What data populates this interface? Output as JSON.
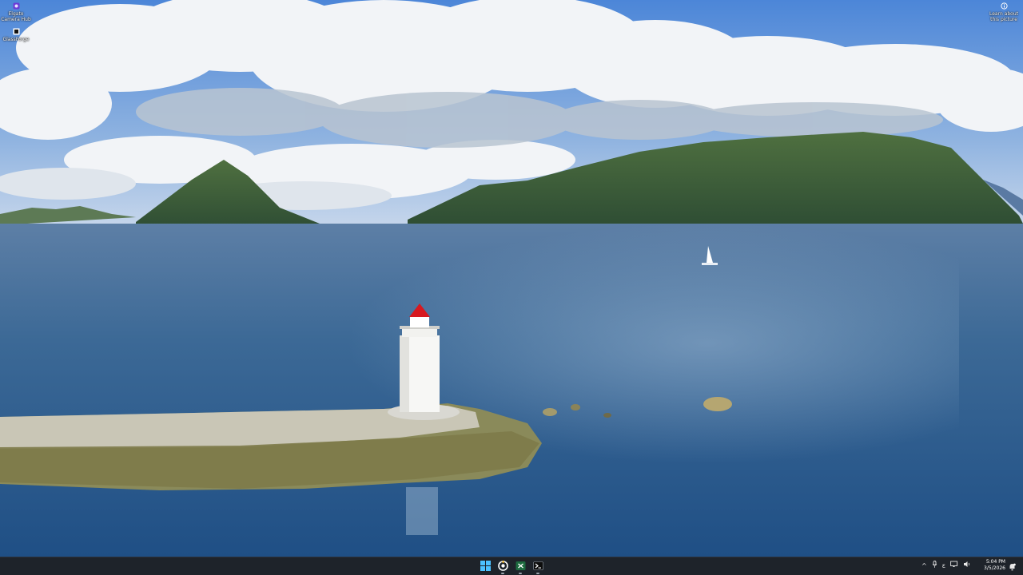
{
  "desktop": {
    "icons": [
      {
        "label": "Elgato Camera Hub",
        "icon": "camera-hub-icon"
      },
      {
        "label": "GlassForge",
        "icon": "glassforge-icon"
      }
    ],
    "spotlight": {
      "label": "Learn about this picture",
      "icon": "info-icon"
    }
  },
  "taskbar": {
    "apps": [
      {
        "name": "start",
        "icon": "windows-start-icon"
      },
      {
        "name": "app-1",
        "icon": "target-app-icon"
      },
      {
        "name": "app-2",
        "icon": "excel-like-icon"
      },
      {
        "name": "app-3",
        "icon": "terminal-app-icon"
      }
    ],
    "tray": {
      "chevron": "^",
      "ime": "ε",
      "time": "5:04 PM",
      "date": "3/5/2026"
    }
  },
  "colors": {
    "taskbar_bg": "#1e232a",
    "sky_top": "#4f86d6",
    "water": "#2c5d92",
    "lighthouse_cap": "#d71920"
  }
}
